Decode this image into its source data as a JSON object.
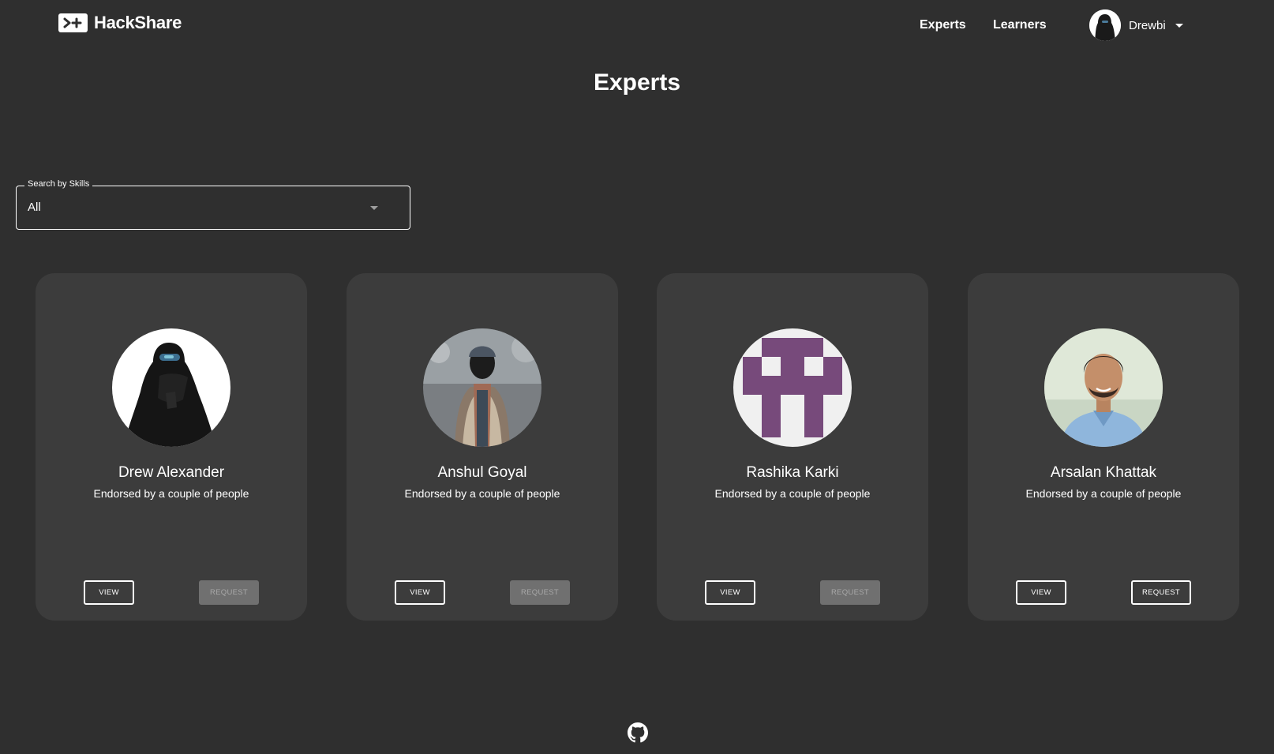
{
  "brand": {
    "name": "HackShare",
    "icon": "terminal-plus-icon"
  },
  "nav": {
    "links": [
      {
        "label": "Experts"
      },
      {
        "label": "Learners"
      }
    ],
    "user": {
      "name": "Drewbi",
      "avatar": "hooded-figure-avatar"
    }
  },
  "page": {
    "title": "Experts"
  },
  "search": {
    "label": "Search by Skills",
    "value": "All"
  },
  "experts": [
    {
      "name": "Drew Alexander",
      "subtitle": "Endorsed by a couple of people",
      "view_label": "VIEW",
      "request_label": "REQUEST",
      "request_enabled": false,
      "avatar": "hooded-figure-avatar"
    },
    {
      "name": "Anshul Goyal",
      "subtitle": "Endorsed by a couple of people",
      "view_label": "VIEW",
      "request_label": "REQUEST",
      "request_enabled": false,
      "avatar": "fur-coat-person-avatar"
    },
    {
      "name": "Rashika Karki",
      "subtitle": "Endorsed by a couple of people",
      "view_label": "VIEW",
      "request_label": "REQUEST",
      "request_enabled": false,
      "avatar": "identicon-avatar"
    },
    {
      "name": "Arsalan Khattak",
      "subtitle": "Endorsed by a couple of people",
      "view_label": "VIEW",
      "request_label": "REQUEST",
      "request_enabled": true,
      "avatar": "smiling-man-avatar"
    }
  ],
  "footer": {
    "icon": "github-icon"
  },
  "colors": {
    "background": "#2f2f2f",
    "card": "#3c3c3c",
    "identicon": "#774a7b",
    "disabled_button": "#707070"
  }
}
